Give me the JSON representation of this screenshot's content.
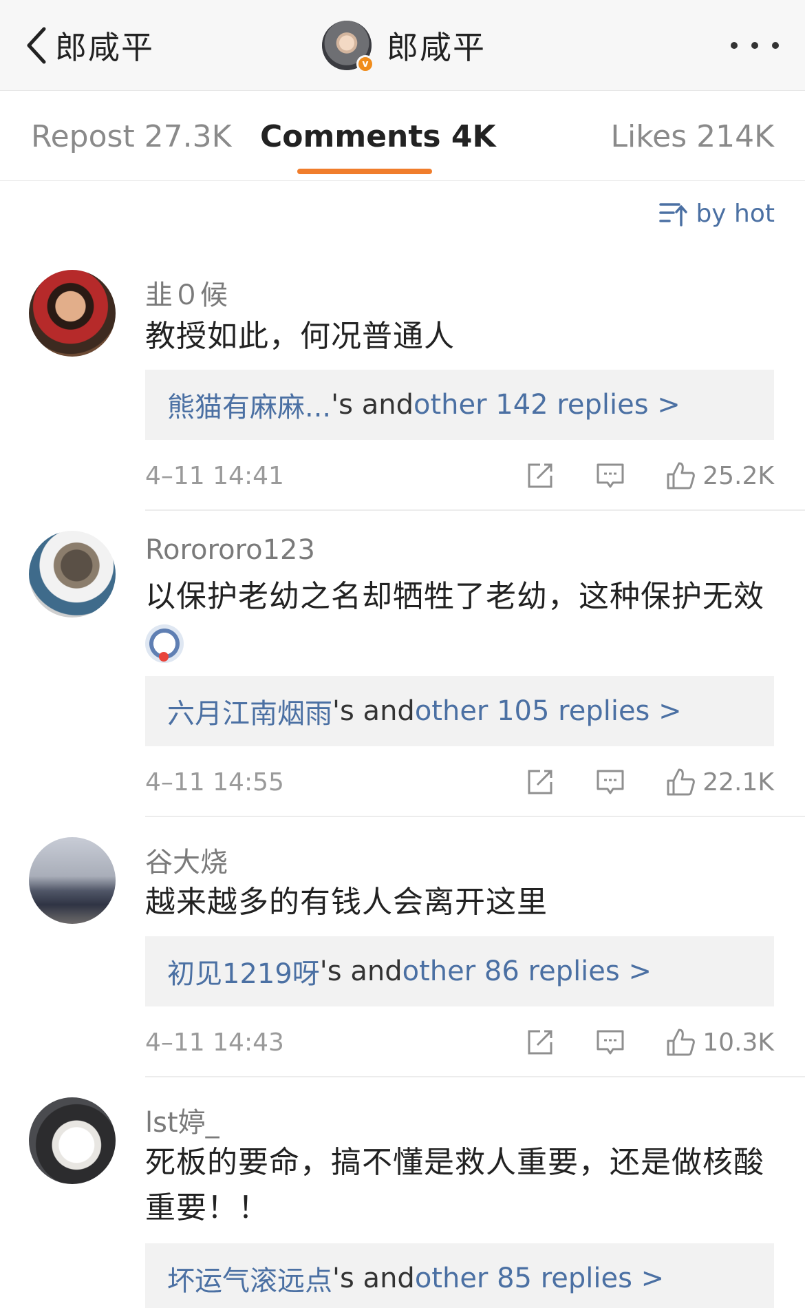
{
  "header": {
    "back_label": "郎咸平",
    "title": "郎咸平",
    "verified_badge": "v",
    "back_icon": "chevron-left-icon",
    "more_icon": "more-dots-icon"
  },
  "tabs": [
    {
      "label": "Repost 27.3K",
      "active": false
    },
    {
      "label": "Comments 4K",
      "active": true
    },
    {
      "label": "Likes 214K",
      "active": false
    }
  ],
  "colors": {
    "accent": "#f07d2c",
    "link": "#4b70a3"
  },
  "sort": {
    "label": "by hot",
    "icon": "sort-icon"
  },
  "comments": [
    {
      "username": "韭０候",
      "text": "教授如此，何况普通人",
      "reply_user": "熊猫有麻麻...",
      "reply_mid": "'s and ",
      "reply_more": "other 142 replies >",
      "time": "4–11 14:41",
      "likes": "25.2K"
    },
    {
      "username": "Rorororo123",
      "text": "以保护老幼之名却牺牲了老幼，这种保护无效",
      "emoji": "doge-emoji",
      "reply_user": "六月江南烟雨",
      "reply_mid": "'s and ",
      "reply_more": "other 105 replies >",
      "time": "4–11 14:55",
      "likes": "22.1K"
    },
    {
      "username": "谷大烧",
      "text": "越来越多的有钱人会离开这里",
      "reply_user": "初见1219呀",
      "reply_mid": "'s and ",
      "reply_more": "other 86 replies >",
      "time": "4–11 14:43",
      "likes": "10.3K"
    },
    {
      "username": "lst婷_",
      "text": "死板的要命，搞不懂是救人重要，还是做核酸重要！！",
      "reply_user": "坏运气滚远点",
      "reply_mid": "'s and ",
      "reply_more": "other 85 replies >",
      "time": "",
      "likes": ""
    }
  ]
}
